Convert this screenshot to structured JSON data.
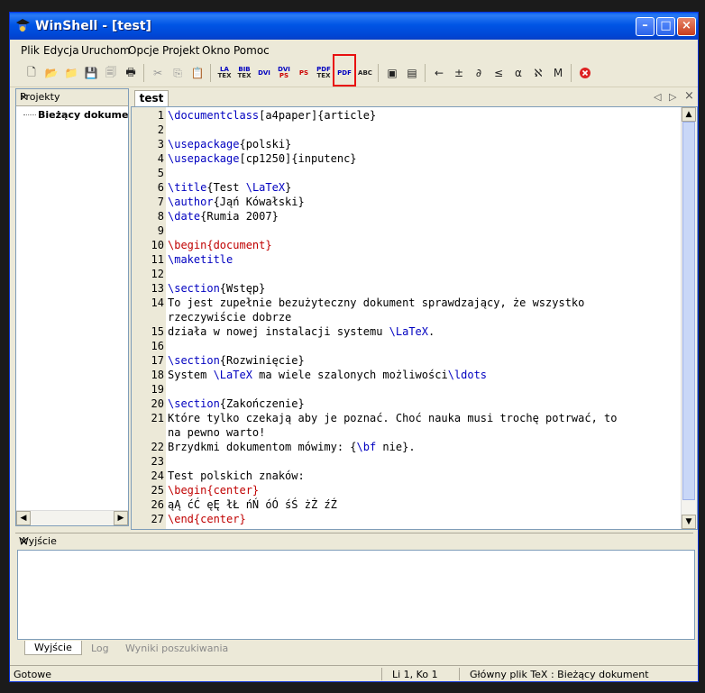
{
  "window": {
    "title": "WinShell - [test]"
  },
  "menu": [
    "Plik",
    "Edycja",
    "Uruchom",
    "Opcje",
    "Projekt",
    "Okno",
    "Pomoc"
  ],
  "toolbar": {
    "tex_labels": [
      {
        "top": "LA",
        "bottom": "TEX"
      },
      {
        "top": "BIB",
        "bottom": "TEX"
      },
      {
        "top": "DVI",
        "bottom": ""
      },
      {
        "top": "DVI",
        "bottom": "PS"
      },
      {
        "top": "PS",
        "bottom": ""
      },
      {
        "top": "PDF",
        "bottom": "TEX"
      },
      {
        "top": "PDF",
        "bottom": ""
      },
      {
        "top": "ABC",
        "bottom": ""
      }
    ],
    "symbols": [
      "←",
      "±",
      "∂",
      "≤",
      "α",
      "ℵ",
      "M"
    ]
  },
  "projects": {
    "title": "Projekty",
    "item": "Bieżący dokumen"
  },
  "editor": {
    "tab": "test",
    "lines": [
      {
        "n": "1",
        "html": "<span class=\"cmd\">\\documentclass</span>[a4paper]{article}"
      },
      {
        "n": "2",
        "html": ""
      },
      {
        "n": "3",
        "html": "<span class=\"cmd\">\\usepackage</span>{polski}"
      },
      {
        "n": "4",
        "html": "<span class=\"cmd\">\\usepackage</span>[cp1250]{inputenc}"
      },
      {
        "n": "5",
        "html": ""
      },
      {
        "n": "6",
        "html": "<span class=\"cmd\">\\title</span>{Test <span class=\"cmd\">\\LaTeX</span>}"
      },
      {
        "n": "7",
        "html": "<span class=\"cmd\">\\author</span>{Jąń Kówałski}"
      },
      {
        "n": "8",
        "html": "<span class=\"cmd\">\\date</span>{Rumia 2007}"
      },
      {
        "n": "9",
        "html": ""
      },
      {
        "n": "10",
        "html": "<span class=\"env\">\\begin{document}</span>"
      },
      {
        "n": "11",
        "html": "<span class=\"cmd\">\\maketitle</span>"
      },
      {
        "n": "12",
        "html": ""
      },
      {
        "n": "13",
        "html": "<span class=\"cmd\">\\section</span>{Wstęp}"
      },
      {
        "n": "14",
        "html": "To jest zupełnie bezużyteczny dokument sprawdzający, że wszystko"
      },
      {
        "n": "",
        "html": "rzeczywiście dobrze"
      },
      {
        "n": "15",
        "html": "działa w nowej instalacji systemu <span class=\"cmd\">\\LaTeX</span>."
      },
      {
        "n": "16",
        "html": ""
      },
      {
        "n": "17",
        "html": "<span class=\"cmd\">\\section</span>{Rozwinięcie}"
      },
      {
        "n": "18",
        "html": "System <span class=\"cmd\">\\LaTeX</span> ma wiele szalonych możliwości<span class=\"cmd\">\\ldots</span>"
      },
      {
        "n": "19",
        "html": ""
      },
      {
        "n": "20",
        "html": "<span class=\"cmd\">\\section</span>{Zakończenie}"
      },
      {
        "n": "21",
        "html": "Które tylko czekają aby je poznać. Choć nauka musi trochę potrwać, to"
      },
      {
        "n": "",
        "html": "na pewno warto!"
      },
      {
        "n": "22",
        "html": "Brzydkmi dokumentom mówimy: {<span class=\"cmd\">\\bf</span> nie}."
      },
      {
        "n": "23",
        "html": ""
      },
      {
        "n": "24",
        "html": "Test polskich znaków:"
      },
      {
        "n": "25",
        "html": "<span class=\"env\">\\begin{center}</span>"
      },
      {
        "n": "26",
        "html": "ąĄ ćĆ ęĘ łŁ ńŃ óÓ śŚ żŻ źŹ"
      },
      {
        "n": "27",
        "html": "<span class=\"env\">\\end{center}</span>"
      }
    ]
  },
  "output": {
    "title": "Wyjście",
    "tabs": [
      "Wyjście",
      "Log",
      "Wyniki poszukiwania"
    ]
  },
  "status": {
    "left": "Gotowe",
    "pos": "Li 1, Ko 1",
    "main": "Główny plik TeX : Bieżący dokument"
  }
}
